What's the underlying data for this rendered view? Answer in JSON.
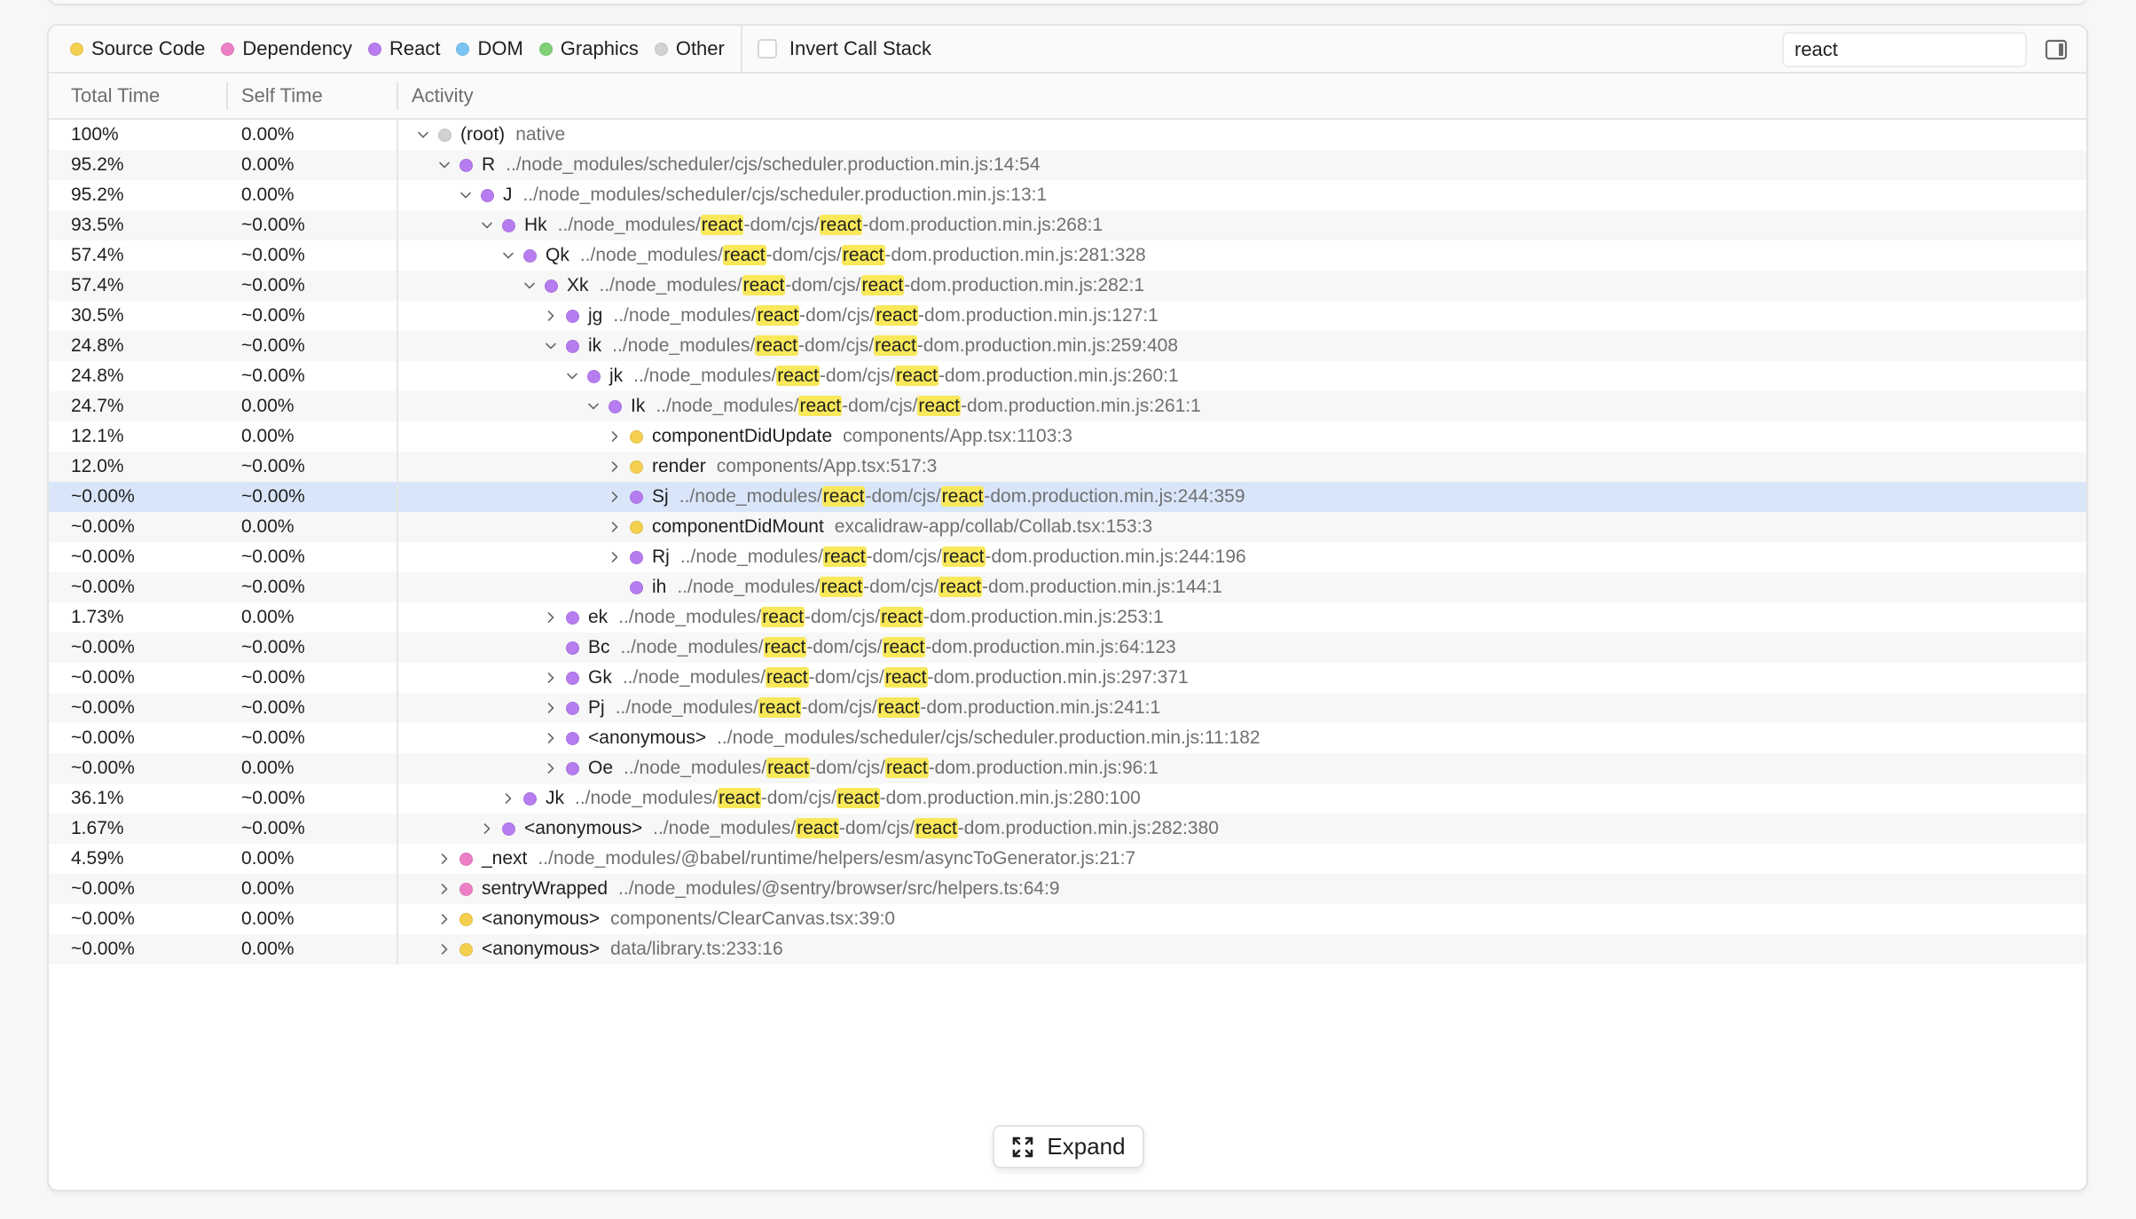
{
  "legend": [
    {
      "label": "Source Code",
      "color": "#f5d04f",
      "icon": "source-code-dot"
    },
    {
      "label": "Dependency",
      "color": "#ec7fc6",
      "icon": "dependency-dot"
    },
    {
      "label": "React",
      "color": "#b77cf0",
      "icon": "react-dot"
    },
    {
      "label": "DOM",
      "color": "#7ac4f4",
      "icon": "dom-dot"
    },
    {
      "label": "Graphics",
      "color": "#7fd077",
      "icon": "graphics-dot"
    },
    {
      "label": "Other",
      "color": "#d2d2d2",
      "icon": "other-dot"
    }
  ],
  "invert_call_stack": {
    "label": "Invert Call Stack",
    "checked": false
  },
  "search": {
    "value": "react",
    "placeholder": ""
  },
  "sidebar_toggle_icon": "sidebar-panel-icon",
  "columns": {
    "total": "Total Time",
    "self": "Self Time",
    "activity": "Activity"
  },
  "highlight_term": "react",
  "category_colors": {
    "source": "#f5d04f",
    "dependency": "#ec7fc6",
    "react": "#b77cf0",
    "other": "#d2d2d2"
  },
  "rows": [
    {
      "total": "100%",
      "self": "0.00%",
      "depth": 0,
      "expander": "expanded",
      "category": "other",
      "name": "(root)",
      "location": "native"
    },
    {
      "total": "95.2%",
      "self": "0.00%",
      "depth": 1,
      "expander": "expanded",
      "category": "react",
      "name": "R",
      "location": "../node_modules/scheduler/cjs/scheduler.production.min.js:14:54"
    },
    {
      "total": "95.2%",
      "self": "0.00%",
      "depth": 2,
      "expander": "expanded",
      "category": "react",
      "name": "J",
      "location": "../node_modules/scheduler/cjs/scheduler.production.min.js:13:1"
    },
    {
      "total": "93.5%",
      "self": "~0.00%",
      "depth": 3,
      "expander": "expanded",
      "category": "react",
      "name": "Hk",
      "location": "../node_modules/react-dom/cjs/react-dom.production.min.js:268:1"
    },
    {
      "total": "57.4%",
      "self": "~0.00%",
      "depth": 4,
      "expander": "expanded",
      "category": "react",
      "name": "Qk",
      "location": "../node_modules/react-dom/cjs/react-dom.production.min.js:281:328"
    },
    {
      "total": "57.4%",
      "self": "~0.00%",
      "depth": 5,
      "expander": "expanded",
      "category": "react",
      "name": "Xk",
      "location": "../node_modules/react-dom/cjs/react-dom.production.min.js:282:1"
    },
    {
      "total": "30.5%",
      "self": "~0.00%",
      "depth": 6,
      "expander": "collapsed",
      "category": "react",
      "name": "jg",
      "location": "../node_modules/react-dom/cjs/react-dom.production.min.js:127:1"
    },
    {
      "total": "24.8%",
      "self": "~0.00%",
      "depth": 6,
      "expander": "expanded",
      "category": "react",
      "name": "ik",
      "location": "../node_modules/react-dom/cjs/react-dom.production.min.js:259:408"
    },
    {
      "total": "24.8%",
      "self": "~0.00%",
      "depth": 7,
      "expander": "expanded",
      "category": "react",
      "name": "jk",
      "location": "../node_modules/react-dom/cjs/react-dom.production.min.js:260:1"
    },
    {
      "total": "24.7%",
      "self": "0.00%",
      "depth": 8,
      "expander": "expanded",
      "category": "react",
      "name": "Ik",
      "location": "../node_modules/react-dom/cjs/react-dom.production.min.js:261:1"
    },
    {
      "total": "12.1%",
      "self": "0.00%",
      "depth": 9,
      "expander": "collapsed",
      "category": "source",
      "name": "componentDidUpdate",
      "location": "components/App.tsx:1103:3"
    },
    {
      "total": "12.0%",
      "self": "~0.00%",
      "depth": 9,
      "expander": "collapsed",
      "category": "source",
      "name": "render",
      "location": "components/App.tsx:517:3"
    },
    {
      "total": "~0.00%",
      "self": "~0.00%",
      "depth": 9,
      "expander": "collapsed",
      "category": "react",
      "name": "Sj",
      "location": "../node_modules/react-dom/cjs/react-dom.production.min.js:244:359",
      "selected": true
    },
    {
      "total": "~0.00%",
      "self": "0.00%",
      "depth": 9,
      "expander": "collapsed",
      "category": "source",
      "name": "componentDidMount",
      "location": "excalidraw-app/collab/Collab.tsx:153:3"
    },
    {
      "total": "~0.00%",
      "self": "~0.00%",
      "depth": 9,
      "expander": "collapsed",
      "category": "react",
      "name": "Rj",
      "location": "../node_modules/react-dom/cjs/react-dom.production.min.js:244:196"
    },
    {
      "total": "~0.00%",
      "self": "~0.00%",
      "depth": 9,
      "expander": "none",
      "category": "react",
      "name": "ih",
      "location": "../node_modules/react-dom/cjs/react-dom.production.min.js:144:1"
    },
    {
      "total": "1.73%",
      "self": "0.00%",
      "depth": 6,
      "expander": "collapsed",
      "category": "react",
      "name": "ek",
      "location": "../node_modules/react-dom/cjs/react-dom.production.min.js:253:1"
    },
    {
      "total": "~0.00%",
      "self": "~0.00%",
      "depth": 6,
      "expander": "none",
      "category": "react",
      "name": "Bc",
      "location": "../node_modules/react-dom/cjs/react-dom.production.min.js:64:123"
    },
    {
      "total": "~0.00%",
      "self": "~0.00%",
      "depth": 6,
      "expander": "collapsed",
      "category": "react",
      "name": "Gk",
      "location": "../node_modules/react-dom/cjs/react-dom.production.min.js:297:371"
    },
    {
      "total": "~0.00%",
      "self": "~0.00%",
      "depth": 6,
      "expander": "collapsed",
      "category": "react",
      "name": "Pj",
      "location": "../node_modules/react-dom/cjs/react-dom.production.min.js:241:1"
    },
    {
      "total": "~0.00%",
      "self": "~0.00%",
      "depth": 6,
      "expander": "collapsed",
      "category": "react",
      "name": "<anonymous>",
      "location": "../node_modules/scheduler/cjs/scheduler.production.min.js:11:182"
    },
    {
      "total": "~0.00%",
      "self": "0.00%",
      "depth": 6,
      "expander": "collapsed",
      "category": "react",
      "name": "Oe",
      "location": "../node_modules/react-dom/cjs/react-dom.production.min.js:96:1"
    },
    {
      "total": "36.1%",
      "self": "~0.00%",
      "depth": 4,
      "expander": "collapsed",
      "category": "react",
      "name": "Jk",
      "location": "../node_modules/react-dom/cjs/react-dom.production.min.js:280:100"
    },
    {
      "total": "1.67%",
      "self": "~0.00%",
      "depth": 3,
      "expander": "collapsed",
      "category": "react",
      "name": "<anonymous>",
      "location": "../node_modules/react-dom/cjs/react-dom.production.min.js:282:380"
    },
    {
      "total": "4.59%",
      "self": "0.00%",
      "depth": 1,
      "expander": "collapsed",
      "category": "dependency",
      "name": "_next",
      "location": "../node_modules/@babel/runtime/helpers/esm/asyncToGenerator.js:21:7"
    },
    {
      "total": "~0.00%",
      "self": "0.00%",
      "depth": 1,
      "expander": "collapsed",
      "category": "dependency",
      "name": "sentryWrapped",
      "location": "../node_modules/@sentry/browser/src/helpers.ts:64:9"
    },
    {
      "total": "~0.00%",
      "self": "0.00%",
      "depth": 1,
      "expander": "collapsed",
      "category": "source",
      "name": "<anonymous>",
      "location": "components/ClearCanvas.tsx:39:0"
    },
    {
      "total": "~0.00%",
      "self": "0.00%",
      "depth": 1,
      "expander": "collapsed",
      "category": "source",
      "name": "<anonymous>",
      "location": "data/library.ts:233:16"
    }
  ],
  "expand_button": {
    "label": "Expand",
    "icon": "expand-arrows-icon"
  }
}
